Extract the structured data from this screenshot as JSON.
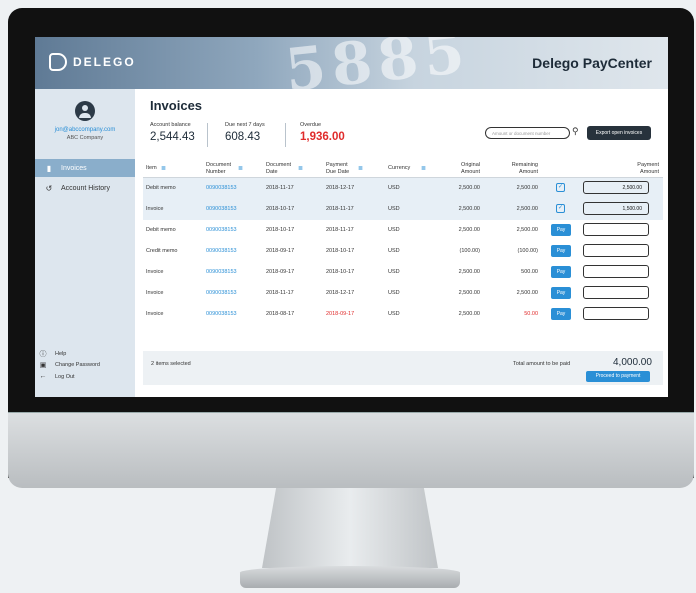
{
  "app": {
    "logo": "DELEGO",
    "brand": "Delego PayCenter",
    "banner_digits": "5885"
  },
  "user": {
    "email": "jon@abccompany.com",
    "company": "ABC Company"
  },
  "sidebar": {
    "items": [
      {
        "label": "Invoices",
        "icon": "document-icon"
      },
      {
        "label": "Account History",
        "icon": "history-icon"
      }
    ],
    "footer": [
      {
        "label": "Help",
        "icon": "help-icon"
      },
      {
        "label": "Change Password",
        "icon": "lock-icon"
      },
      {
        "label": "Log Out",
        "icon": "arrow-left-icon"
      }
    ]
  },
  "page": {
    "title": "Invoices",
    "stats": [
      {
        "label": "Account balance",
        "value": "2,544.43"
      },
      {
        "label": "Due next 7 days",
        "value": "608.43"
      },
      {
        "label": "Overdue",
        "value": "1,936.00"
      }
    ],
    "search_placeholder": "Amount or document number",
    "export_label": "Export open invoices"
  },
  "table": {
    "headers": [
      "Item",
      "Document Number",
      "Document Date",
      "Payment Due Date",
      "Currency",
      "Original Amount",
      "Remaining Amount",
      "Payment Amount"
    ],
    "header_lines": [
      [
        "Item"
      ],
      [
        "Document",
        "Number"
      ],
      [
        "Document",
        "Date"
      ],
      [
        "Payment",
        "Due Date"
      ],
      [
        "Currency"
      ],
      [
        "Original",
        "Amount"
      ],
      [
        "Remaining",
        "Amount"
      ],
      [
        "Payment",
        "Amount"
      ]
    ],
    "rows": [
      {
        "item": "Debit memo",
        "doc": "0090038153",
        "date": "2018-11-17",
        "due": "2018-12-17",
        "cur": "USD",
        "orig": "2,500.00",
        "rem": "2,500.00",
        "action": "check",
        "pay": "2,500.00"
      },
      {
        "item": "Invoice",
        "doc": "0090038153",
        "date": "2018-10-17",
        "due": "2018-11-17",
        "cur": "USD",
        "orig": "2,500.00",
        "rem": "2,500.00",
        "action": "check",
        "pay": "1,500.00"
      },
      {
        "item": "Debit memo",
        "doc": "0090038153",
        "date": "2018-10-17",
        "due": "2018-11-17",
        "cur": "USD",
        "orig": "2,500.00",
        "rem": "2,500.00",
        "action": "Pay",
        "pay": ""
      },
      {
        "item": "Credit memo",
        "doc": "0090038153",
        "date": "2018-09-17",
        "due": "2018-10-17",
        "cur": "USD",
        "orig": "(100.00)",
        "rem": "(100.00)",
        "action": "Pay",
        "pay": ""
      },
      {
        "item": "Invoice",
        "doc": "0090038153",
        "date": "2018-09-17",
        "due": "2018-10-17",
        "cur": "USD",
        "orig": "2,500.00",
        "rem": "500.00",
        "action": "Pay",
        "pay": ""
      },
      {
        "item": "Invoice",
        "doc": "0090038153",
        "date": "2018-11-17",
        "due": "2018-12-17",
        "cur": "USD",
        "orig": "2,500.00",
        "rem": "2,500.00",
        "action": "Pay",
        "pay": ""
      },
      {
        "item": "Invoice",
        "doc": "0090038153",
        "date": "2018-08-17",
        "due": "2018-09-17",
        "cur": "USD",
        "orig": "2,500.00",
        "rem": "50.00",
        "action": "Pay",
        "pay": "",
        "overdue": true
      }
    ]
  },
  "summary": {
    "selected": "2 items selected",
    "total_label": "Total amount to be paid",
    "total_value": "4,000.00",
    "proceed_label": "Proceed to payment"
  },
  "colors": {
    "accent": "#2a8fd6",
    "overdue": "#e02b2b",
    "dark": "#27323c",
    "sidebar": "#dde6ee"
  }
}
